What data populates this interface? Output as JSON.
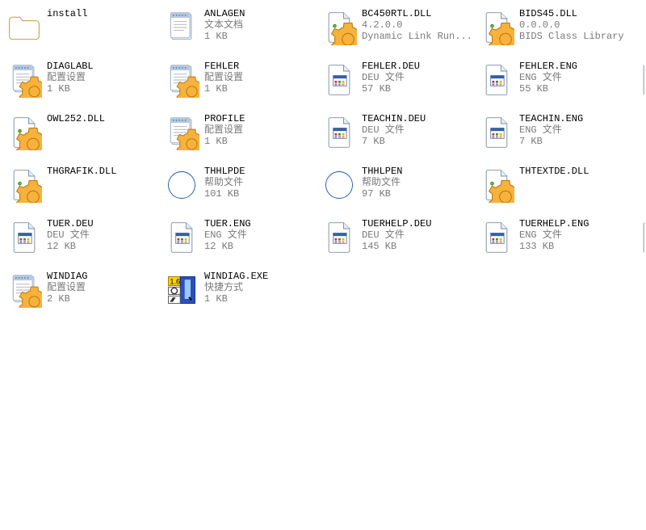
{
  "items": [
    {
      "name": "install",
      "type": "",
      "size": "",
      "icon": "folder"
    },
    {
      "name": "ANLAGEN",
      "type": "文本文档",
      "size": "1 KB",
      "icon": "txt"
    },
    {
      "name": "BC450RTL.DLL",
      "type": "4.2.0.0",
      "size": "Dynamic Link Run...",
      "icon": "dll"
    },
    {
      "name": "BIDS45.DLL",
      "type": "0.0.0.0",
      "size": "BIDS Class Library",
      "icon": "dll"
    },
    {
      "name": "DIAGLABL",
      "type": "配置设置",
      "size": "1 KB",
      "icon": "config"
    },
    {
      "name": "FEHLER",
      "type": "配置设置",
      "size": "1 KB",
      "icon": "config"
    },
    {
      "name": "FEHLER.DEU",
      "type": "DEU 文件",
      "size": "57 KB",
      "icon": "doc"
    },
    {
      "name": "FEHLER.ENG",
      "type": "ENG 文件",
      "size": "55 KB",
      "icon": "doc"
    },
    {
      "name": "OWL252.DLL",
      "type": "",
      "size": "",
      "icon": "dll"
    },
    {
      "name": "PROFILE",
      "type": "配置设置",
      "size": "1 KB",
      "icon": "config"
    },
    {
      "name": "TEACHIN.DEU",
      "type": "DEU 文件",
      "size": "7 KB",
      "icon": "doc"
    },
    {
      "name": "TEACHIN.ENG",
      "type": "ENG 文件",
      "size": "7 KB",
      "icon": "doc"
    },
    {
      "name": "THGRAFIK.DLL",
      "type": "",
      "size": "",
      "icon": "dll"
    },
    {
      "name": "THHLPDE",
      "type": "帮助文件",
      "size": "101 KB",
      "icon": "help"
    },
    {
      "name": "THHLPEN",
      "type": "帮助文件",
      "size": "97 KB",
      "icon": "help"
    },
    {
      "name": "THTEXTDE.DLL",
      "type": "",
      "size": "",
      "icon": "dll"
    },
    {
      "name": "TUER.DEU",
      "type": "DEU 文件",
      "size": "12 KB",
      "icon": "doc"
    },
    {
      "name": "TUER.ENG",
      "type": "ENG 文件",
      "size": "12 KB",
      "icon": "doc"
    },
    {
      "name": "TUERHELP.DEU",
      "type": "DEU 文件",
      "size": "145 KB",
      "icon": "doc"
    },
    {
      "name": "TUERHELP.ENG",
      "type": "ENG 文件",
      "size": "133 KB",
      "icon": "doc"
    },
    {
      "name": "WINDIAG",
      "type": "配置设置",
      "size": "2 KB",
      "icon": "config"
    },
    {
      "name": "WINDIAG.EXE",
      "type": "快捷方式",
      "size": "1 KB",
      "icon": "exe"
    }
  ],
  "row_clips": {
    "1": true,
    "4": true
  }
}
